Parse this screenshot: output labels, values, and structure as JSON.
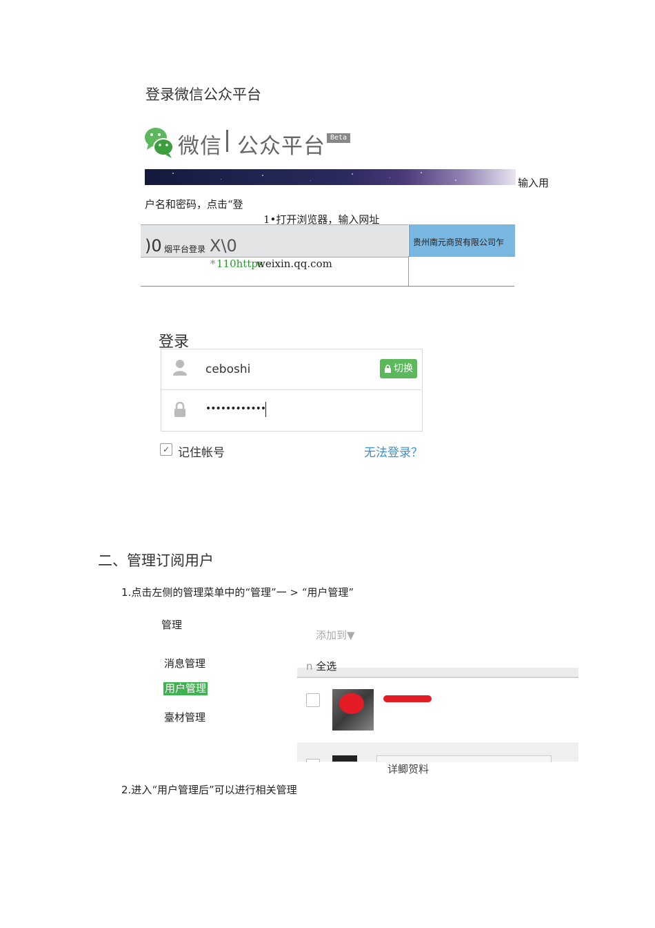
{
  "section1": {
    "title": "登录微信公众平台",
    "brand": {
      "name1": "微信",
      "name2": "公众平台",
      "badge": "Beta"
    },
    "text_input_user": "输入用",
    "text_username_line": "户名和密码，点击“登",
    "step1": "1•打开浏览器，输入网址",
    "browser": {
      "tab_glyph": ")0",
      "tab_title": "烟平台登录",
      "tab_close": "X\\0",
      "company": "贵州南元商贸有限公司乍",
      "url_star": "*",
      "url_prefix": "110https",
      "url_domain": "weixin.qq.com"
    }
  },
  "login_form": {
    "heading": "登录",
    "username": "ceboshi",
    "switch_label": "切换",
    "password_mask": "••••••••••••",
    "remember_label": "记住帐号",
    "remember_checked": true,
    "cant_login": "无法登录？"
  },
  "section2": {
    "heading": "二、管理订阅用户",
    "step1_num": "1.",
    "step1_text": "点击左侧的管理菜单中的“管理”一 > “用户管理”",
    "menu": {
      "heading": "管理",
      "items": [
        "消息管理",
        "用户管理",
        "臺材管理"
      ],
      "active_index": 1
    },
    "list": {
      "add_to": "添加到▼",
      "select_all_box": "n",
      "select_all": "全选",
      "detail_label": "详鲫贺料"
    },
    "step2_num": "2.",
    "step2_text": "进入“用户管理后”可以进行相关管理"
  },
  "colors": {
    "accent_green": "#3fb34f",
    "switch_green": "#5cb85c",
    "link_blue": "#3c8fd4",
    "company_blue": "#79b6e0",
    "url_green": "#2a9a2a",
    "redaction_red": "#e31c25"
  }
}
